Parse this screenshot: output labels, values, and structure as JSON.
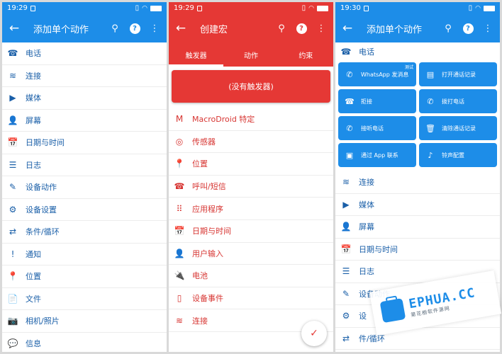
{
  "colors": {
    "accent_blue": "#1d8de8",
    "accent_red": "#e53835"
  },
  "screen1": {
    "time": "19:29",
    "title": "添加单个动作",
    "items": [
      {
        "icon": "☎",
        "label": "电话",
        "icon_name": "phone-icon"
      },
      {
        "icon": "≋",
        "label": "连接",
        "icon_name": "connectivity-icon"
      },
      {
        "icon": "▶",
        "label": "媒体",
        "icon_name": "media-play-icon"
      },
      {
        "icon": "👤",
        "label": "屏幕",
        "icon_name": "person-icon"
      },
      {
        "icon": "📅",
        "label": "日期与时间",
        "icon_name": "calendar-icon"
      },
      {
        "icon": "☰",
        "label": "日志",
        "icon_name": "list-icon"
      },
      {
        "icon": "✎",
        "label": "设备动作",
        "icon_name": "magic-wand-icon"
      },
      {
        "icon": "⚙",
        "label": "设备设置",
        "icon_name": "settings-icon"
      },
      {
        "icon": "⇄",
        "label": "条件/循环",
        "icon_name": "loop-icon"
      },
      {
        "icon": "!",
        "label": "通知",
        "icon_name": "notification-icon"
      },
      {
        "icon": "📍",
        "label": "位置",
        "icon_name": "location-icon"
      },
      {
        "icon": "📄",
        "label": "文件",
        "icon_name": "file-icon"
      },
      {
        "icon": "📷",
        "label": "相机/照片",
        "icon_name": "camera-icon"
      },
      {
        "icon": "💬",
        "label": "信息",
        "icon_name": "message-icon"
      }
    ]
  },
  "screen2": {
    "time": "19:29",
    "title": "创建宏",
    "tabs": [
      "触发器",
      "动作",
      "约束"
    ],
    "no_trigger": "(没有触发器)",
    "items": [
      {
        "icon": "M",
        "label": "MacroDroid 特定",
        "icon_name": "macrodroid-icon"
      },
      {
        "icon": "◎",
        "label": "传感器",
        "icon_name": "compass-icon"
      },
      {
        "icon": "📍",
        "label": "位置",
        "icon_name": "location-icon"
      },
      {
        "icon": "☎",
        "label": "呼叫/短信",
        "icon_name": "phone-icon"
      },
      {
        "icon": "⠿",
        "label": "应用程序",
        "icon_name": "apps-grid-icon"
      },
      {
        "icon": "📅",
        "label": "日期与时间",
        "icon_name": "calendar-icon"
      },
      {
        "icon": "👤",
        "label": "用户输入",
        "icon_name": "person-icon"
      },
      {
        "icon": "🔌",
        "label": "电池",
        "icon_name": "power-plug-icon"
      },
      {
        "icon": "▯",
        "label": "设备事件",
        "icon_name": "phone-device-icon"
      },
      {
        "icon": "≋",
        "label": "连接",
        "icon_name": "connectivity-icon"
      }
    ],
    "fab_icon": "✓"
  },
  "screen3": {
    "time": "19:30",
    "title": "添加单个动作",
    "section": "电话",
    "tiles": [
      {
        "icon": "✆",
        "label": "WhatsApp 发消息",
        "tag": "测试",
        "icon_name": "whatsapp-icon"
      },
      {
        "icon": "▤",
        "label": "打开通话记录",
        "tag": "",
        "icon_name": "contact-card-icon"
      },
      {
        "icon": "☎",
        "label": "拒接",
        "tag": "",
        "icon_name": "hang-up-icon"
      },
      {
        "icon": "✆",
        "label": "拨打电话",
        "tag": "",
        "icon_name": "outgoing-call-icon"
      },
      {
        "icon": "✆",
        "label": "接听电话",
        "tag": "",
        "icon_name": "answer-call-icon"
      },
      {
        "icon": "🗑",
        "label": "清除通话记录",
        "tag": "",
        "icon_name": "trash-icon"
      },
      {
        "icon": "▣",
        "label": "通过 App 联系",
        "tag": "",
        "icon_name": "contact-app-icon"
      },
      {
        "icon": "♪",
        "label": "铃声配置",
        "tag": "",
        "icon_name": "ringtone-icon"
      }
    ],
    "items": [
      {
        "icon": "≋",
        "label": "连接",
        "icon_name": "connectivity-icon"
      },
      {
        "icon": "▶",
        "label": "媒体",
        "icon_name": "media-play-icon"
      },
      {
        "icon": "👤",
        "label": "屏幕",
        "icon_name": "person-icon"
      },
      {
        "icon": "📅",
        "label": "日期与时间",
        "icon_name": "calendar-icon"
      },
      {
        "icon": "☰",
        "label": "日志",
        "icon_name": "list-icon"
      },
      {
        "icon": "✎",
        "label": "设备动作",
        "icon_name": "magic-wand-icon"
      },
      {
        "icon": "⚙",
        "label": "设",
        "icon_name": "settings-icon"
      },
      {
        "icon": "⇄",
        "label": "件/循环",
        "icon_name": "loop-icon"
      }
    ]
  },
  "watermark": {
    "brand": "EPHUA.CC",
    "sub": "第花樹软件源网"
  }
}
